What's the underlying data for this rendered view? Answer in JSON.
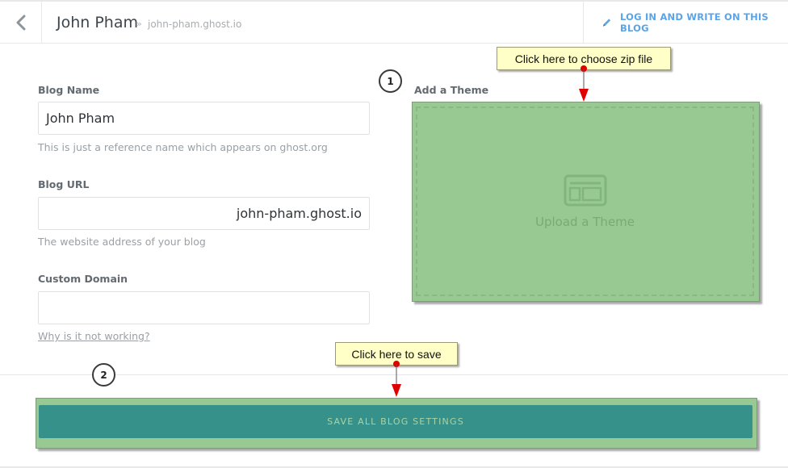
{
  "header": {
    "back_icon": "chevron-left-icon",
    "blog_title": "John Pham",
    "breadcrumb_separator": "»",
    "blog_url": "john-pham.ghost.io",
    "login_icon": "pencil-icon",
    "login_label": "LOG IN AND WRITE ON THIS BLOG"
  },
  "form": {
    "blog_name": {
      "label": "Blog Name",
      "value": "John Pham",
      "hint": "This is just a reference name which appears on ghost.org"
    },
    "blog_url": {
      "label": "Blog URL",
      "value_subdomain": "john-pham",
      "value_domain": ".ghost.io",
      "hint": "The website address of your blog"
    },
    "custom_domain": {
      "label": "Custom Domain",
      "value": "",
      "help_link": "Why is it not working?"
    }
  },
  "theme": {
    "label": "Add a Theme",
    "upload_icon": "layout-icon",
    "upload_label": "Upload a Theme"
  },
  "annotations": {
    "step1": "1",
    "step2": "2",
    "tooltip_zip": "Click here to choose zip file",
    "tooltip_save": "Click here to save"
  },
  "footer": {
    "save_label": "SAVE ALL BLOG SETTINGS"
  },
  "colors": {
    "accent_blue": "#5ba4e5",
    "save_button": "#35918a",
    "highlight_green": "#98c992",
    "tooltip_bg": "#ffffc7",
    "arrow_red": "#e00000"
  }
}
